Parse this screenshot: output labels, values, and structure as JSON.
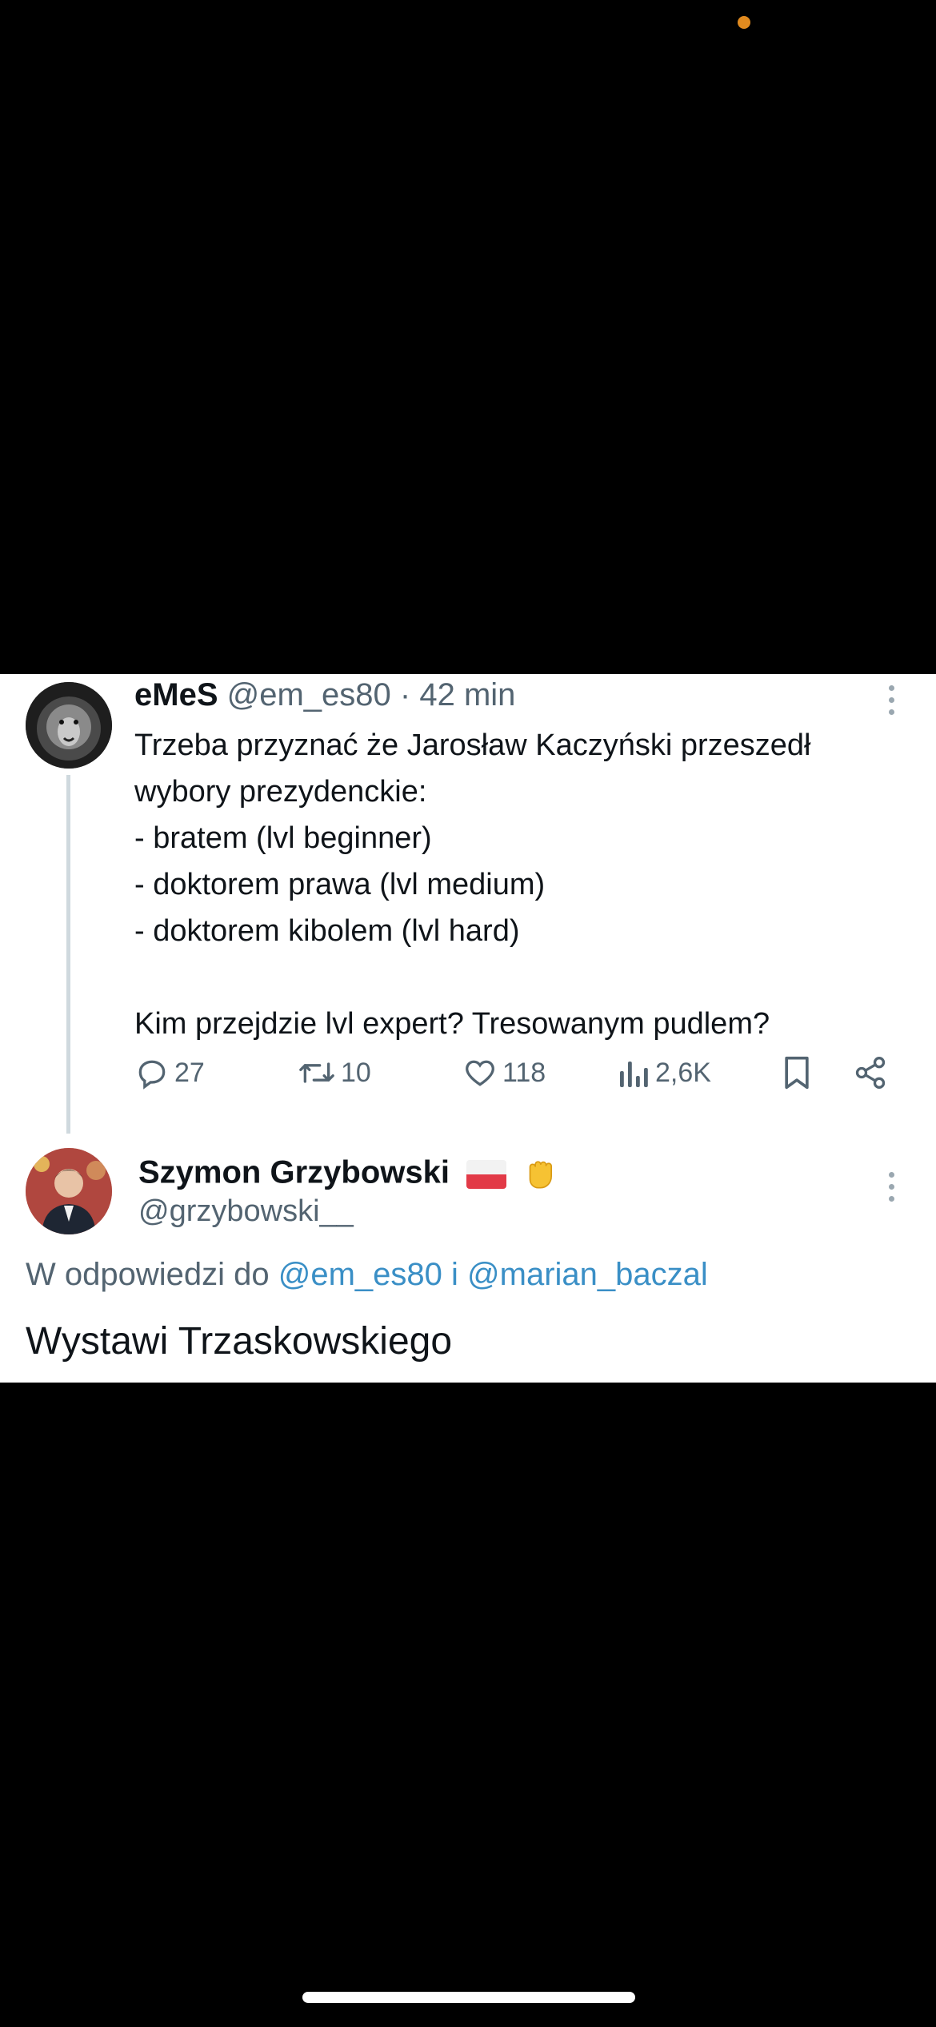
{
  "tweet": {
    "author_name": "eMeS",
    "author_handle": "@em_es80",
    "separator": "·",
    "time": "42 min",
    "lines": [
      "Trzeba przyznać że Jarosław Kaczyński przeszedł",
      "wybory prezydenckie:",
      "- bratem (lvl beginner)",
      "- doktorem prawa (lvl medium)",
      "- doktorem kibolem (lvl hard)",
      "",
      "Kim przejdzie lvl expert? Tresowanym pudlem?"
    ],
    "stats": {
      "replies": "27",
      "retweets": "10",
      "likes": "118",
      "views": "2,6K"
    }
  },
  "reply": {
    "author_name": "Szymon Grzybowski",
    "author_handle": "@grzybowski__",
    "reply_prefix": "W odpowiedzi do",
    "mention1": "@em_es80",
    "conjunction": "i",
    "mention2": "@marian_baczal",
    "text": "Wystawi Trzaskowskiego"
  },
  "colors": {
    "background": "#000000",
    "card": "#ffffff",
    "text": "#0f1419",
    "muted": "#536471",
    "link": "#3a8fc6",
    "status_dot": "#e08a1f"
  },
  "icons": [
    "reply-icon",
    "retweet-icon",
    "like-icon",
    "views-icon",
    "bookmark-icon",
    "share-icon",
    "more-icon",
    "poland-flag-icon",
    "raised-fist-icon"
  ]
}
